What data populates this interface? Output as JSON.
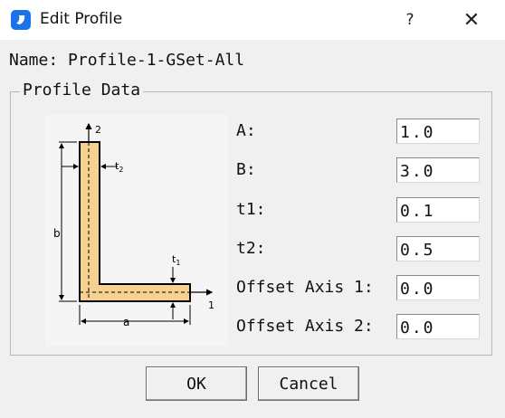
{
  "window": {
    "title": "Edit Profile",
    "help_glyph": "?",
    "close_glyph": "✕",
    "icon": "app-icon",
    "accent": "#1a73e8"
  },
  "name_row": {
    "text": "Name: Profile-1-GSet-All"
  },
  "profile_group": {
    "title": "Profile Data",
    "diagram": {
      "labels": {
        "axis2": "2",
        "axis1": "1",
        "t2": "t",
        "t2_sub": "2",
        "t1": "t",
        "t1_sub": "1",
        "b": "b",
        "a": "a"
      },
      "fill_color": "#f7d18f"
    },
    "fields": [
      {
        "label": "A:",
        "value": "1.0"
      },
      {
        "label": "B:",
        "value": "3.0"
      },
      {
        "label": "t1:",
        "value": "0.1"
      },
      {
        "label": "t2:",
        "value": "0.5"
      },
      {
        "label": "Offset Axis 1:",
        "value": "0.0"
      },
      {
        "label": "Offset Axis 2:",
        "value": "0.0"
      }
    ]
  },
  "buttons": {
    "ok": "OK",
    "cancel": "Cancel"
  }
}
